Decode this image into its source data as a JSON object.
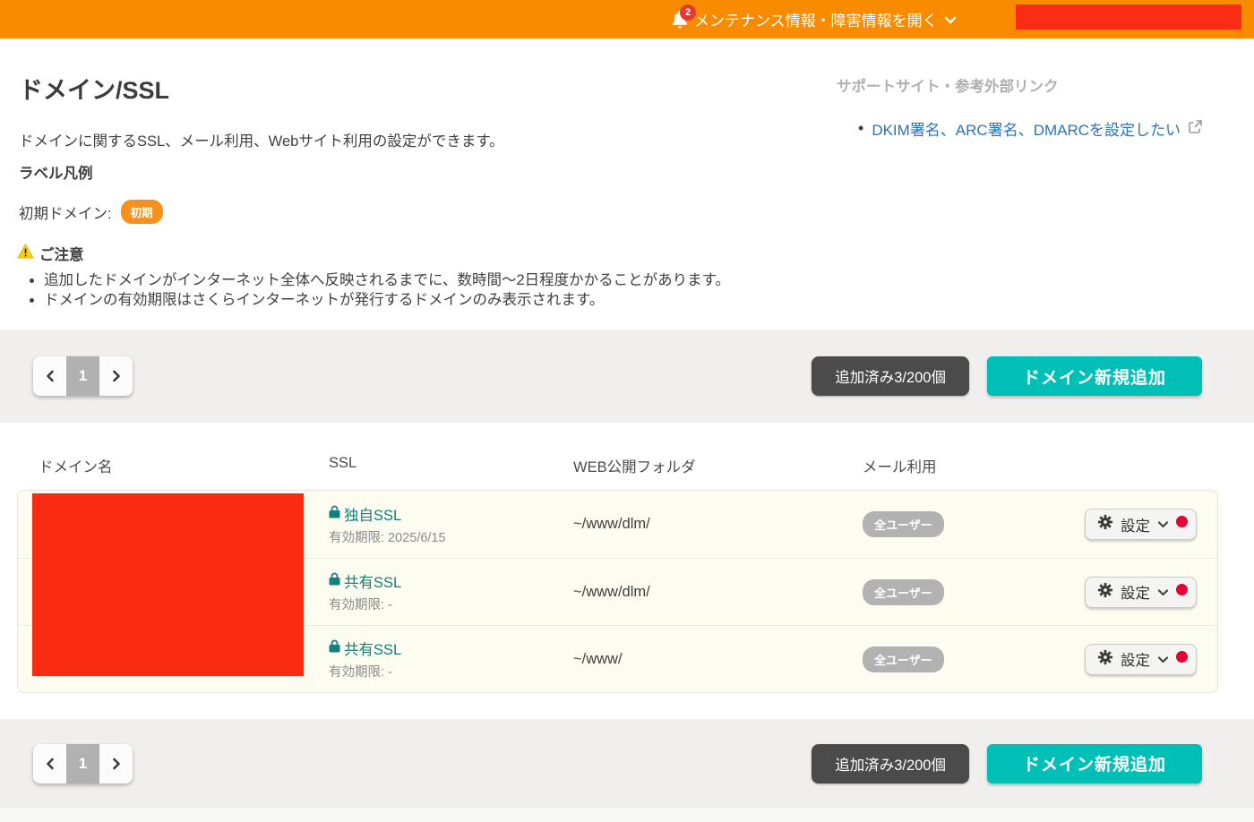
{
  "colors": {
    "header_bg": "#f88b00",
    "accent_teal": "#00bfb6",
    "badge_orange": "#f5921e",
    "notification_red": "#e8392b",
    "redacted_red": "#f92c13",
    "ssl_link_teal": "#15807b",
    "support_link_blue": "#2a72bc",
    "settings_dot_red": "#e60033",
    "mail_pill_gray": "#b2b2b2",
    "count_button_gray": "#4b4b4b"
  },
  "header": {
    "notification_count": "2",
    "maintenance_link": "メンテナンス情報・障害情報を開く"
  },
  "page": {
    "title": "ドメイン/SSL",
    "description": "ドメインに関するSSL、メール利用、Webサイト利用の設定ができます。",
    "legend": {
      "heading": "ラベル凡例",
      "item_label": "初期ドメイン:",
      "badge": "初期"
    },
    "notice": {
      "heading": "ご注意",
      "items": [
        "追加したドメインがインターネット全体へ反映されるまでに、数時間〜2日程度かかることがあります。",
        "ドメインの有効期限はさくらインターネットが発行するドメインのみ表示されます。"
      ]
    }
  },
  "support": {
    "heading": "サポートサイト・参考外部リンク",
    "link": "DKIM署名、ARC署名、DMARCを設定したい"
  },
  "toolbar": {
    "page": "1",
    "count": "追加済み3/200個",
    "add_domain": "ドメイン新規追加"
  },
  "table": {
    "headers": {
      "domain": "ドメイン名",
      "ssl": "SSL",
      "web": "WEB公開フォルダ",
      "mail": "メール利用"
    },
    "rows": [
      {
        "ssl_type": "独自SSL",
        "expiry": "有効期限: 2025/6/15",
        "folder": "~/www/dlm/",
        "mail_badge": "全ユーザー",
        "settings": "設定"
      },
      {
        "ssl_type": "共有SSL",
        "expiry": "有効期限: -",
        "folder": "~/www/dlm/",
        "mail_badge": "全ユーザー",
        "settings": "設定"
      },
      {
        "ssl_type": "共有SSL",
        "expiry": "有効期限: -",
        "folder": "~/www/",
        "mail_badge": "全ユーザー",
        "settings": "設定"
      }
    ]
  }
}
